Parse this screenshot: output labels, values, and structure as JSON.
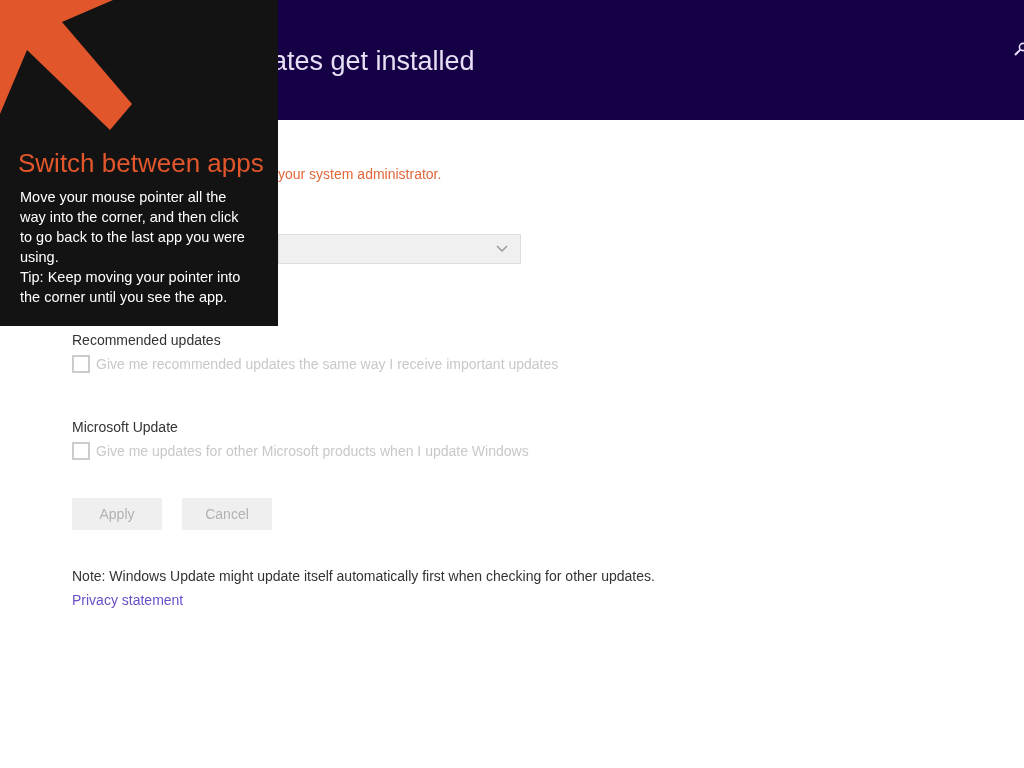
{
  "header": {
    "title": "ates get installed"
  },
  "notice": "your system administrator.",
  "dropdown": {
    "disabled": true
  },
  "sections": [
    {
      "heading": "Recommended updates",
      "checkbox": {
        "label": "Give me recommended updates the same way I receive important updates",
        "checked": false,
        "disabled": true
      }
    },
    {
      "heading": "Microsoft Update",
      "checkbox": {
        "label": "Give me updates for other Microsoft products when I update Windows",
        "checked": false,
        "disabled": true
      }
    }
  ],
  "buttons": [
    {
      "label": "Apply",
      "disabled": true
    },
    {
      "label": "Cancel",
      "disabled": true
    }
  ],
  "note": "Note: Windows Update might update itself automatically first when checking for other updates.",
  "link": "Privacy statement",
  "tip_overlay": {
    "title": "Switch between apps",
    "body": "Move your mouse pointer all the way into the corner, and then click to go back to the last app you were using.",
    "tip": "Tip: Keep moving your pointer into the corner until you see the app."
  }
}
